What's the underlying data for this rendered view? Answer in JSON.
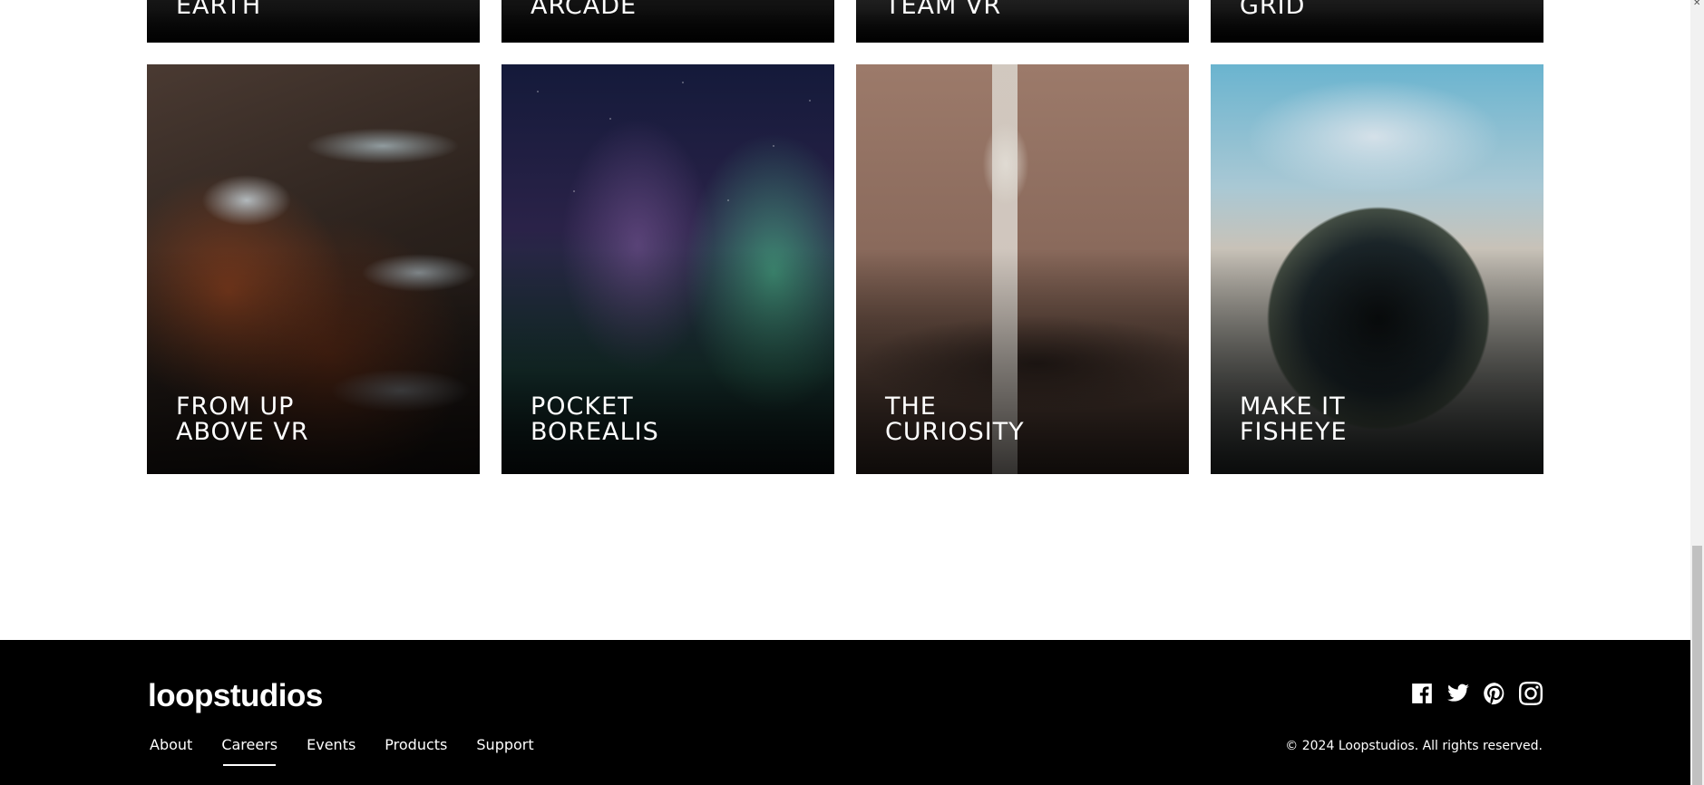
{
  "creations": {
    "top_row": [
      {
        "title": "EARTH"
      },
      {
        "title": "ARCADE"
      },
      {
        "title": "TEAM VR"
      },
      {
        "title": "GRID"
      }
    ],
    "main_row": [
      {
        "title": "FROM UP\nABOVE VR"
      },
      {
        "title": "POCKET\nBOREALIS"
      },
      {
        "title": "THE\nCURIOSITY"
      },
      {
        "title": "MAKE IT\nFISHEYE"
      }
    ]
  },
  "footer": {
    "logo": "loopstudios",
    "nav": [
      "About",
      "Careers",
      "Events",
      "Products",
      "Support"
    ],
    "active_nav": "Careers",
    "socials": [
      "facebook-icon",
      "twitter-icon",
      "pinterest-icon",
      "instagram-icon"
    ],
    "copyright": "© 2024 Loopstudios. All rights reserved."
  },
  "colors": {
    "background": "#ffffff",
    "footer_bg": "#000000",
    "text_light": "#ffffff"
  }
}
